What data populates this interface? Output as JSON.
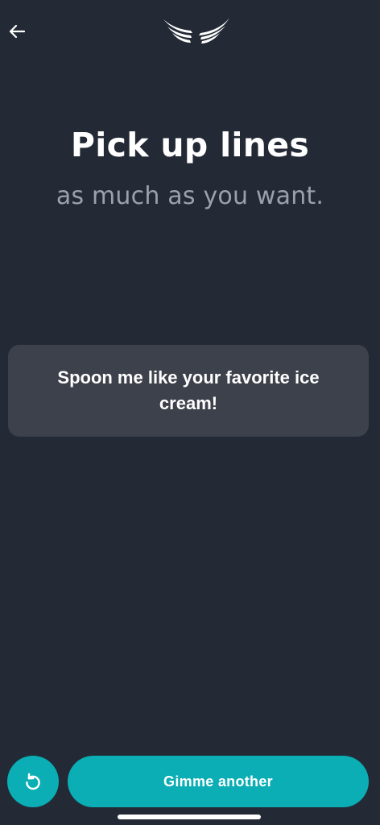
{
  "header": {
    "back_icon": "arrow-left-icon",
    "logo_icon": "wings-logo-icon"
  },
  "main": {
    "title": "Pick up lines",
    "subtitle": "as much as you want.",
    "line_card": {
      "text": "Spoon me like your favorite ice cream!"
    }
  },
  "footer": {
    "refresh_icon": "refresh-icon",
    "another_label": "Gimme another"
  },
  "colors": {
    "background": "#232a35",
    "card": "#3c414b",
    "accent": "#0aaeb4",
    "subtitle": "#9aa1ab"
  }
}
